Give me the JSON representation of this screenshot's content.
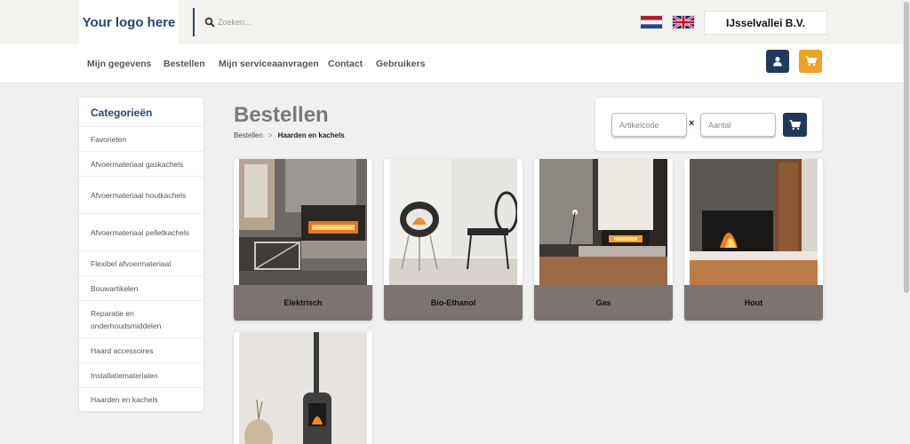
{
  "header": {
    "logo_text": "Your logo here",
    "search_placeholder": "Zoeken...",
    "languages": [
      "nl-flag-icon",
      "uk-flag-icon"
    ],
    "company_name": "IJsselvallei B.V."
  },
  "nav": {
    "items": [
      "Mijn gegevens",
      "Bestellen",
      "Mijn serviceaanvragen",
      "Contact",
      "Gebruikers"
    ],
    "user_icon": "user-icon",
    "cart_icon": "cart-icon"
  },
  "sidebar": {
    "title": "Categorieën",
    "categories": [
      "Favorieten",
      "Afvoermateriaal gaskachels",
      "Afvoermateriaal houtkachels",
      "Afvoermateriaal pelletkachels",
      "Flexibel afvoermateriaal",
      "Bouwartikelen",
      "Reparatie en onderhoudsmiddelen",
      "Haard accessoires",
      "Installatiematerialen",
      "Haarden en kachels"
    ]
  },
  "main": {
    "title": "Bestellen",
    "breadcrumb": [
      "Bestellen",
      "Haarden en kachels"
    ],
    "breadcrumb_sep": ">"
  },
  "quick_order": {
    "article_placeholder": "Artikelcode",
    "quantity_placeholder": "Aantal",
    "times": "×"
  },
  "products": [
    {
      "label": "Elektrisch"
    },
    {
      "label": "Bio-Ethanol"
    },
    {
      "label": "Gas"
    },
    {
      "label": "Hout"
    },
    {
      "label": ""
    }
  ],
  "colors": {
    "brand_navy": "#1f3a5c",
    "accent_orange": "#f0a022",
    "card_label_bg": "#7b7471"
  }
}
